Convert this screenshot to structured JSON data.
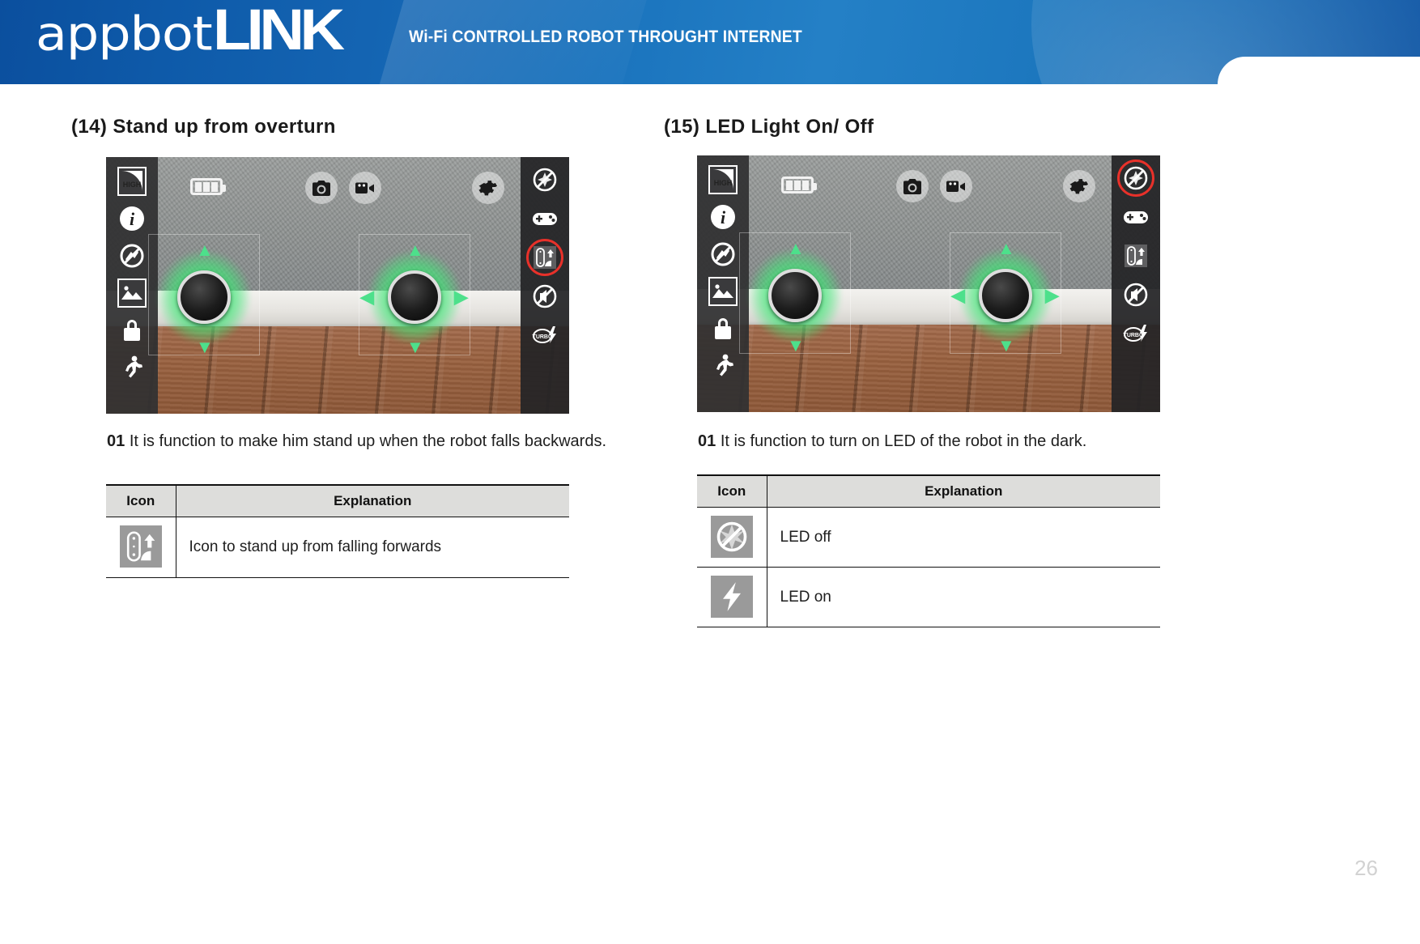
{
  "header": {
    "brand_primary": "appbot",
    "brand_secondary": "LINK",
    "tagline": "Wi-Fi CONTROLLED ROBOT THROUGHT INTERNET",
    "brand_color": "#1464b2"
  },
  "page": {
    "number": "26",
    "accent_highlight_color": "#e8312a"
  },
  "sections": [
    {
      "title": "(14) Stand up from overturn",
      "step_number": "01",
      "description": "It is function to make him stand up when the robot falls backwards.",
      "app_screenshot": {
        "left_toolbar": [
          {
            "icon": "high-quality-icon",
            "label": "HIGH"
          },
          {
            "icon": "info-icon",
            "label": "i"
          },
          {
            "icon": "no-signal-icon",
            "label": ""
          },
          {
            "icon": "gallery-icon",
            "label": ""
          },
          {
            "icon": "lock-icon",
            "label": ""
          },
          {
            "icon": "run-icon",
            "label": ""
          }
        ],
        "top_bar": [
          {
            "icon": "battery-icon",
            "label": ""
          },
          {
            "icon": "camera-icon",
            "label": ""
          },
          {
            "icon": "video-camera-icon",
            "label": ""
          },
          {
            "icon": "gear-icon",
            "label": ""
          }
        ],
        "right_toolbar": [
          {
            "icon": "led-off-icon",
            "label": "",
            "highlighted": false
          },
          {
            "icon": "gamepad-icon",
            "label": "",
            "highlighted": false
          },
          {
            "icon": "stand-up-icon",
            "label": "",
            "highlighted": true
          },
          {
            "icon": "mute-icon",
            "label": "",
            "highlighted": false
          },
          {
            "icon": "turbo-icon",
            "label": "",
            "highlighted": false
          }
        ]
      },
      "table": {
        "columns": [
          "Icon",
          "Explanation"
        ],
        "rows": [
          {
            "icon": "stand-up-icon",
            "explanation": "Icon to stand up from falling forwards"
          }
        ]
      }
    },
    {
      "title": "(15) LED Light On/ Off",
      "step_number": "01",
      "description": "It is function to turn on LED of the robot in the dark.",
      "app_screenshot": {
        "left_toolbar": [
          {
            "icon": "high-quality-icon",
            "label": "HIGH"
          },
          {
            "icon": "info-icon",
            "label": "i"
          },
          {
            "icon": "no-signal-icon",
            "label": ""
          },
          {
            "icon": "gallery-icon",
            "label": ""
          },
          {
            "icon": "lock-icon",
            "label": ""
          },
          {
            "icon": "run-icon",
            "label": ""
          }
        ],
        "top_bar": [
          {
            "icon": "battery-icon",
            "label": ""
          },
          {
            "icon": "camera-icon",
            "label": ""
          },
          {
            "icon": "video-camera-icon",
            "label": ""
          },
          {
            "icon": "gear-icon",
            "label": ""
          }
        ],
        "right_toolbar": [
          {
            "icon": "led-off-icon",
            "label": "",
            "highlighted": true
          },
          {
            "icon": "gamepad-icon",
            "label": "",
            "highlighted": false
          },
          {
            "icon": "stand-up-icon",
            "label": "",
            "highlighted": false
          },
          {
            "icon": "mute-icon",
            "label": "",
            "highlighted": false
          },
          {
            "icon": "turbo-icon",
            "label": "",
            "highlighted": false
          }
        ]
      },
      "table": {
        "columns": [
          "Icon",
          "Explanation"
        ],
        "rows": [
          {
            "icon": "led-off-icon",
            "explanation": "LED off"
          },
          {
            "icon": "led-on-icon",
            "explanation": "LED on"
          }
        ]
      }
    }
  ]
}
